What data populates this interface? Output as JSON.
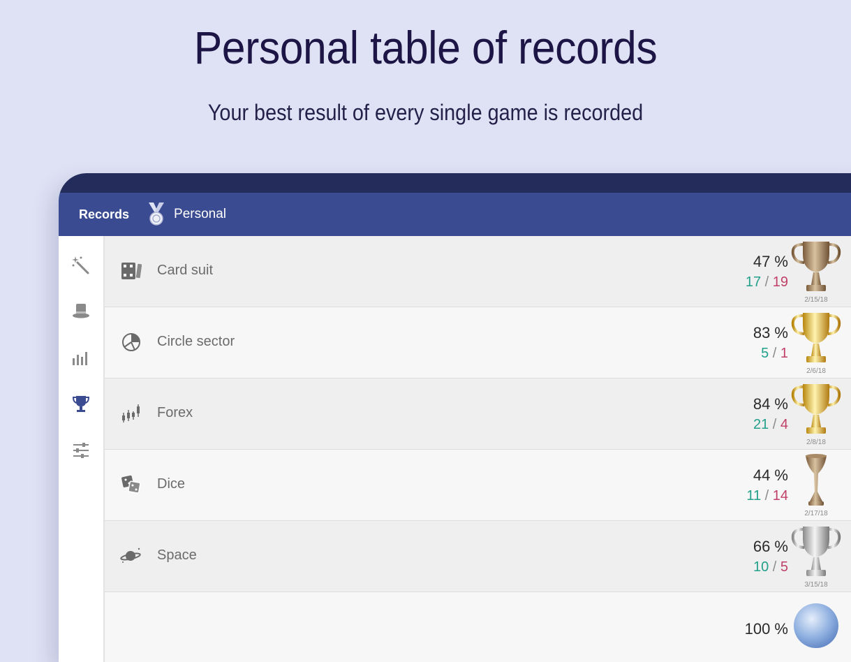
{
  "header": {
    "title": "Personal table of records",
    "subtitle": "Your best result of every single game is recorded"
  },
  "appbar": {
    "title": "Records",
    "subtitle": "Personal",
    "icon": "medal-icon",
    "color": "#3a4b92"
  },
  "rail": [
    {
      "icon": "magic-wand-icon"
    },
    {
      "icon": "top-hat-icon"
    },
    {
      "icon": "bar-chart-icon"
    },
    {
      "icon": "trophy-icon",
      "selected": true
    },
    {
      "icon": "sliders-icon"
    }
  ],
  "records": [
    {
      "name": "Card suit",
      "icon": "cards-icon",
      "percent": "47 %",
      "wins": "17",
      "losses": "19",
      "date": "2/15/18",
      "trophy": "bronze-cup-icon"
    },
    {
      "name": "Circle sector",
      "icon": "pie-icon",
      "percent": "83 %",
      "wins": "5",
      "losses": "1",
      "date": "2/6/18",
      "trophy": "gold-cup-icon"
    },
    {
      "name": "Forex",
      "icon": "candlestick-icon",
      "percent": "84 %",
      "wins": "21",
      "losses": "4",
      "date": "2/8/18",
      "trophy": "gold-cup-icon"
    },
    {
      "name": "Dice",
      "icon": "dice-icon",
      "percent": "44 %",
      "wins": "11",
      "losses": "14",
      "date": "2/17/18",
      "trophy": "bronze-goblet-icon"
    },
    {
      "name": "Space",
      "icon": "planet-icon",
      "percent": "66 %",
      "wins": "10",
      "losses": "5",
      "date": "3/15/18",
      "trophy": "silver-cup-icon"
    },
    {
      "name": "",
      "icon": "",
      "percent": "100 %",
      "wins": "",
      "losses": "",
      "date": "",
      "trophy": "crystal-ball-icon"
    }
  ],
  "colors": {
    "background": "#dfe2f4",
    "statusbar": "#232c5b",
    "wins": "#22a08a",
    "losses": "#c04068"
  }
}
